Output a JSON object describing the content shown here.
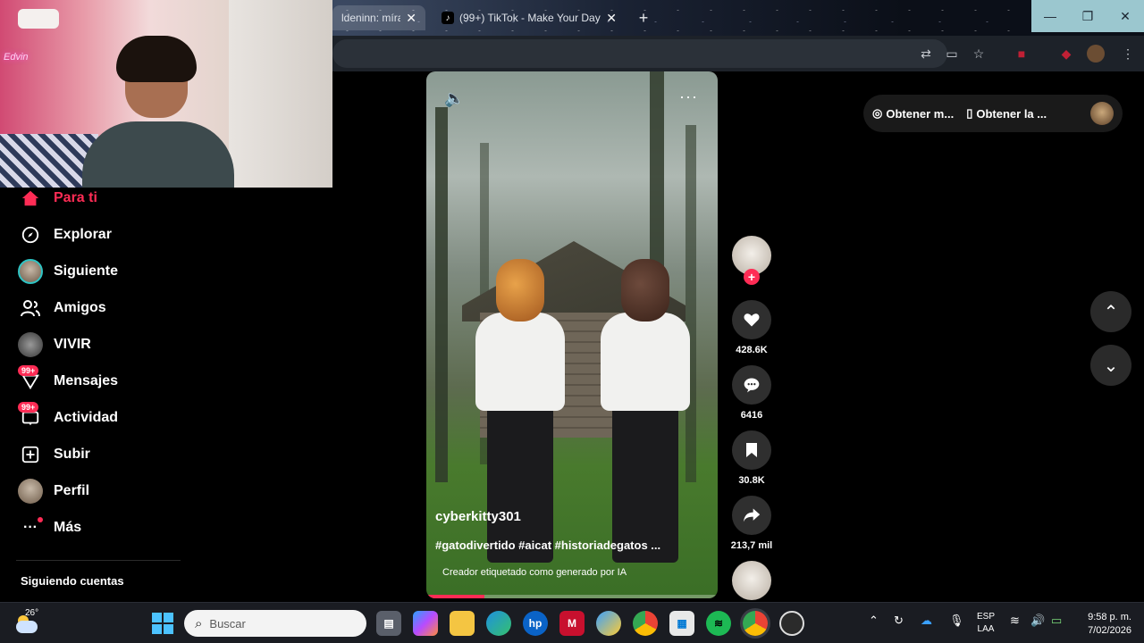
{
  "browser": {
    "tabs": [
      {
        "title": "ldeninn: míral",
        "favicon": "tab-favicon-icon"
      },
      {
        "title": "(99+) TikTok - Make Your Day",
        "favicon": "tiktok-icon"
      }
    ],
    "close_glyph": "✕",
    "new_tab_glyph": "+",
    "window_controls": {
      "minimize": "—",
      "restore": "❐",
      "close": "✕"
    },
    "toolbar_icons": [
      "translate-icon",
      "install-app-icon",
      "bookmark-star-icon",
      "extension-icon",
      "extension-icon",
      "profile-avatar-icon",
      "menu-icon"
    ]
  },
  "webcam": {
    "neon_text": "Edvin"
  },
  "sidebar": {
    "items": [
      {
        "label": "Para ti",
        "icon": "home-icon",
        "active": true
      },
      {
        "label": "Explorar",
        "icon": "compass-icon"
      },
      {
        "label": "Siguiente",
        "icon": "following-avatar-icon"
      },
      {
        "label": "Amigos",
        "icon": "friends-icon"
      },
      {
        "label": "VIVIR",
        "icon": "live-avatar-icon"
      },
      {
        "label": "Mensajes",
        "icon": "messages-icon",
        "badge": "99+"
      },
      {
        "label": "Actividad",
        "icon": "activity-icon",
        "badge": "99+"
      },
      {
        "label": "Subir",
        "icon": "upload-icon"
      },
      {
        "label": "Perfil",
        "icon": "profile-avatar-icon"
      },
      {
        "label": "Más",
        "icon": "more-icon",
        "dot": true
      }
    ],
    "following_header": "Siguiendo cuentas"
  },
  "video": {
    "username": "cyberkitty301",
    "caption": "#gatodivertido #aicat #historiadegatos ...",
    "ai_label": "Creador etiquetado como generado por IA",
    "progress": 0.2,
    "volume_icon": "volume-icon",
    "more_icon": "more-dots-icon"
  },
  "actions": {
    "follow_plus": "+",
    "likes": "428.6K",
    "comments": "6416",
    "saves": "30.8K",
    "shares": "213,7 mil"
  },
  "topright": {
    "get_coins": "Obtener m...",
    "get_app": "Obtener la ..."
  },
  "nav_arrows": {
    "up": "⌃",
    "down": "⌄"
  },
  "taskbar": {
    "temperature": "26°",
    "search_placeholder": "Buscar",
    "language_top": "ESP",
    "language_bottom": "LAA",
    "time": "9:58 p. m.",
    "date": "7/02/2026",
    "apps": [
      "windows-start-icon",
      "task-view-icon",
      "copilot-icon",
      "file-explorer-icon",
      "edge-icon",
      "hp-icon",
      "mcafee-icon",
      "weather-app-icon",
      "chrome-icon",
      "ms-store-icon",
      "spotify-icon",
      "chrome-profile-icon",
      "obs-icon"
    ]
  },
  "colors": {
    "accent": "#fe2c55",
    "background": "#000000",
    "taskbar": "#1a1c22"
  }
}
